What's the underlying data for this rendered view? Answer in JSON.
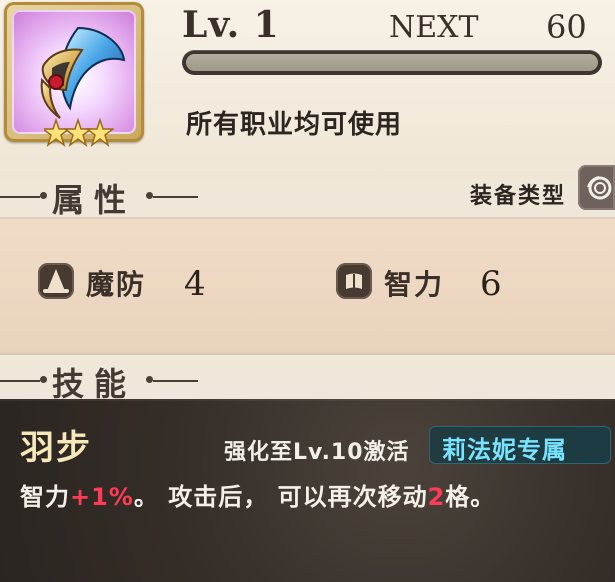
{
  "header": {
    "level_label": "Lv. 1",
    "next_label": "NEXT",
    "next_value": "60",
    "exp_progress": 0
  },
  "item": {
    "rarity_stars": 3,
    "usable_by": "所有职业均可使用"
  },
  "sections": {
    "attributes_title": "属性",
    "skills_title": "技能",
    "equip_type_label": "装备类型"
  },
  "attributes": [
    {
      "label": "魔防",
      "value": "4",
      "icon": "wizard-hat-icon"
    },
    {
      "label": "智力",
      "value": "6",
      "icon": "book-icon"
    }
  ],
  "skill": {
    "name": "羽步",
    "requirement": "强化至Lv.10激活",
    "exclusive": "莉法妮专属",
    "description": {
      "prefix": "智力",
      "highlight_1": "+1%",
      "middle": "。 攻击后， 可以再次移动",
      "highlight_2": "2",
      "suffix": "格。"
    }
  },
  "colors": {
    "skill_name": "#f6e8b9",
    "skill_highlight": "#ff3b55",
    "exclusive_text": "#79e3ff"
  }
}
